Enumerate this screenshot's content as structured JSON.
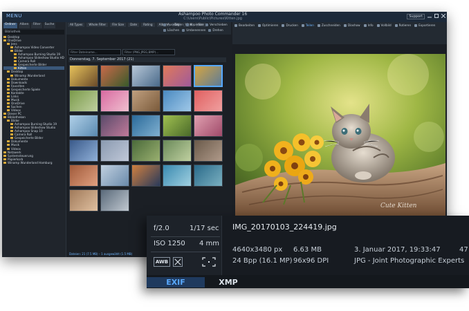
{
  "app": {
    "menu": "MENU",
    "title": "Ashampoo Photo Commander 16",
    "path": "C:\\Users\\Public\\Pictures\\Kitten.jpg",
    "support": "Support"
  },
  "left_panel": {
    "tabs": [
      "Ordner",
      "Alben",
      "Filter",
      "Suche"
    ],
    "address": "Bibliothek",
    "tree": [
      "Desktop",
      "OneDrive",
      "Jens",
      "Ashampoo Video Converter",
      "Bilder",
      "Ashampoo Burning Studio 19",
      "Ashampoo Slideshow Studio HD",
      "Camera Roll",
      "Gespeicherte Bilder",
      "Kitten",
      "Desktop",
      "Winamp Wunderland",
      "Dokumente",
      "Downloads",
      "Favoriten",
      "Gespeicherte Spiele",
      "Kontakte",
      "Links",
      "Musik",
      "OneDrive",
      "Suchen",
      "Videos",
      "Dieser PC",
      "Bibliotheken",
      "Bilder",
      "Ashampoo Burning Studio 19",
      "Ashampoo Slideshow Studio",
      "Ashampoo Snap 10",
      "Camera Roll",
      "Gespeicherte Bilder",
      "Dokumente",
      "Musik",
      "Videos",
      "Netzwerk",
      "Systemsteuerung",
      "Papierkorb",
      "Winamp Wunderland Hamburg"
    ],
    "selected_index": 9
  },
  "browser": {
    "filter_chips": [
      "All Types",
      "Whole Filter",
      "File Size",
      "Date",
      "Rating",
      "Album",
      "Tag",
      "Kind",
      "Size"
    ],
    "tools": [
      "Auswählen",
      "Kopieren",
      "Verschieben",
      "Löschen",
      "Umbenennen",
      "Drehen"
    ],
    "search_placeholder": "Filter Dateiname...",
    "filter_placeholder": "Filter (PNG,JPEG,BMP)...",
    "date_header": "Donnerstag, 7. September 2017 (21)",
    "status": "Dateien: 21 (7.5 MB) – 1 ausgewählt (1.5 MB)",
    "thumbnail_count": 30
  },
  "viewer": {
    "tools": [
      "Bearbeiten",
      "Optimieren",
      "Drucken",
      "Teilen",
      "Zuschneiden",
      "Diashow",
      "Info",
      "Vollbild",
      "Rotieren",
      "Exportieren"
    ],
    "image_subject": "kitten-with-yellow-flowers-on-wooden-log",
    "watermark": "Cute Kitten"
  },
  "exif": {
    "aperture": "f/2.0",
    "exposure": "1/17 sec",
    "iso": "ISO 1250",
    "focal": "4 mm",
    "awb": "AWB",
    "filename": "IMG_20170103_224419.jpg",
    "dims": "4640x3480 px",
    "size": "6.63 MB",
    "date": "3. Januar 2017, 19:33:47",
    "extra": "47",
    "bpp": "24 Bpp (16.1 MP)",
    "dpi": "96x96 DPI",
    "format": "JPG - Joint Photographic Experts",
    "tab_active": "EXIF",
    "tab_other": "XMP"
  }
}
